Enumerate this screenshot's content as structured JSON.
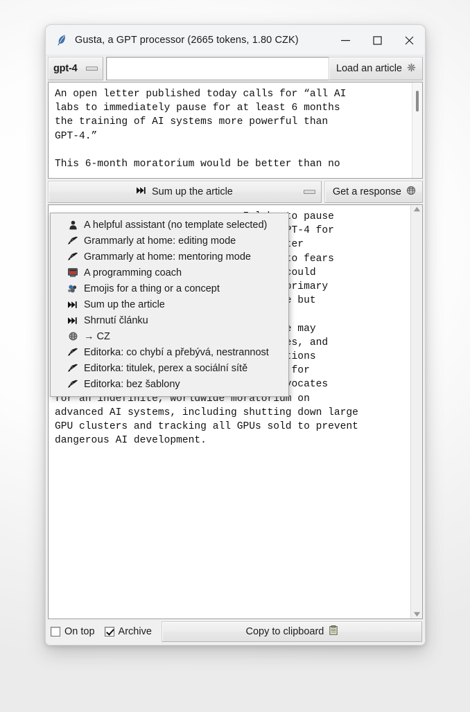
{
  "window": {
    "title": "Gusta, a GPT processor (2665 tokens, 1.80 CZK)",
    "app_icon": "feather-icon",
    "controls": {
      "minimize": "minimize-icon",
      "maximize": "maximize-icon",
      "close": "close-icon"
    }
  },
  "toolbar": {
    "model": {
      "value": "gpt-4",
      "dropdown_icon": "option-menu-icon"
    },
    "url_input": {
      "value": "",
      "placeholder": ""
    },
    "load_article": {
      "label": "Load an article",
      "icon": "gear-asterisk-icon"
    },
    "template": {
      "value": "Sum up the article",
      "icon": "double-arrow-icon",
      "dropdown_icon": "option-menu-icon"
    },
    "get_response": {
      "label": "Get a response",
      "icon": "globe-gear-icon"
    }
  },
  "source_pane": {
    "text": "An open letter published today calls for “all AI\nlabs to immediately pause for at least 6 months\nthe training of AI systems more powerful than\nGPT-4.”\n\nThis 6-month moratorium would be better than no"
  },
  "response_pane": {
    "text": "                               I labs to pause\n                              r than GPT-4 for\n                               the letter\n                               ty due to fears\n                              gent AI could\n                              ty. The primary\n                              elligence but\n                              es human\n                              e that we may\n                              ical lines, and\n                              y precautions\n                              n't care for\n                              ticle advocates\nfor an indefinite, worldwide moratorium on\nadvanced AI systems, including shutting down large\nGPU clusters and tracking all GPUs sold to prevent\ndangerous AI development.",
    "scroll_up_icon": "triangle-up-icon",
    "scroll_down_icon": "triangle-down-icon"
  },
  "menu": {
    "items": [
      {
        "label": "A helpful assistant (no template selected)",
        "icon": "person-icon"
      },
      {
        "label": "Grammarly at home: editing mode",
        "icon": "pencil-icon"
      },
      {
        "label": "Grammarly at home: mentoring mode",
        "icon": "pencil-icon"
      },
      {
        "label": "A programming coach",
        "icon": "computer-icon"
      },
      {
        "label": "Emojis for a thing or a concept",
        "icon": "emoji-cluster-icon"
      },
      {
        "label": "Sum up the article",
        "icon": "double-arrow-icon"
      },
      {
        "label": "Shrnutí článku",
        "icon": "double-arrow-icon"
      },
      {
        "label": "→ CZ",
        "icon": "globe-icon"
      },
      {
        "label": "Editorka: co chybí a přebývá, nestrannost",
        "icon": "pencil-icon"
      },
      {
        "label": "Editorka: titulek, perex a sociální sítě",
        "icon": "pencil-icon"
      },
      {
        "label": "Editorka: bez šablony",
        "icon": "pencil-icon"
      }
    ]
  },
  "statusbar": {
    "on_top": {
      "label": "On top",
      "checked": false
    },
    "archive": {
      "label": "Archive",
      "checked": true
    },
    "copy": {
      "label": "Copy to clipboard",
      "icon": "clipboard-icon"
    }
  },
  "colors": {
    "window_bg": "#f0f0f0",
    "titlebar_bg": "#f3f4f6",
    "text": "#1b1b1b",
    "accent": "#3f6fa8"
  }
}
